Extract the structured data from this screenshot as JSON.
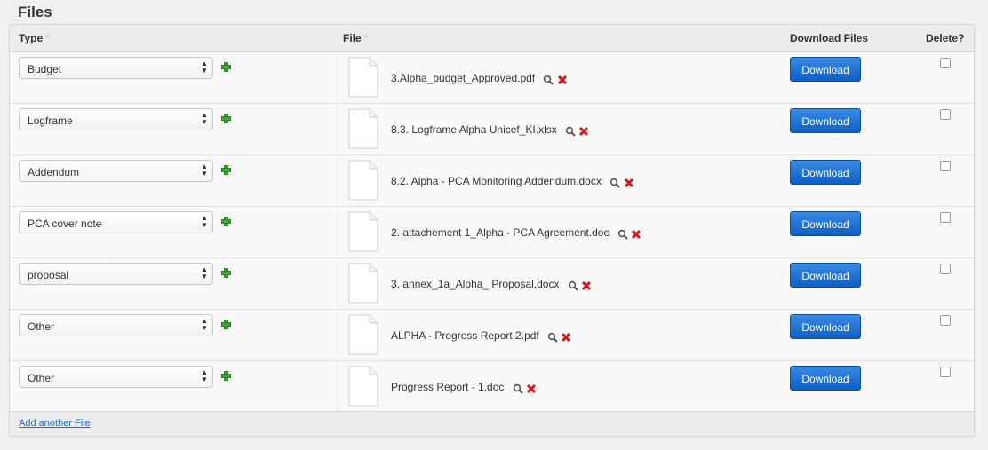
{
  "section": {
    "title": "Files"
  },
  "table": {
    "headers": {
      "type": "Type",
      "file": "File",
      "download": "Download Files",
      "delete": "Delete?"
    },
    "required_marker": "*"
  },
  "rows": [
    {
      "type": "Budget",
      "file": "3.Alpha_budget_Approved.pdf",
      "download_label": "Download",
      "deleted": false
    },
    {
      "type": "Logframe",
      "file": "8.3. Logframe Alpha Unicef_KI.xlsx",
      "download_label": "Download",
      "deleted": false
    },
    {
      "type": "Addendum",
      "file": "8.2. Alpha - PCA Monitoring Addendum.docx",
      "download_label": "Download",
      "deleted": false
    },
    {
      "type": "PCA cover note",
      "file": "2. attachement 1_Alpha - PCA Agreement.doc",
      "download_label": "Download",
      "deleted": false
    },
    {
      "type": "proposal",
      "file": "3. annex_1a_Alpha_ Proposal.docx",
      "download_label": "Download",
      "deleted": false
    },
    {
      "type": "Other",
      "file": "ALPHA - Progress Report 2.pdf",
      "download_label": "Download",
      "deleted": false
    },
    {
      "type": "Other",
      "file": "Progress Report - 1.doc",
      "download_label": "Download",
      "deleted": false
    }
  ],
  "footer": {
    "add_link": "Add another File"
  },
  "icons": {
    "add": "plus-icon",
    "document": "document-icon",
    "view": "magnifier-icon",
    "remove": "delete-x-icon",
    "select_arrows": "select-arrows-icon"
  },
  "colors": {
    "download_button": "#0d5fc4",
    "link": "#1a6fc9",
    "add_icon": "#3fa535",
    "delete_icon": "#cc1a1a"
  }
}
